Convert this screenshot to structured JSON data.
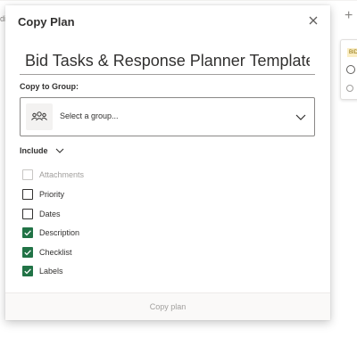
{
  "background": {
    "left_text": "di",
    "card_tag": "BID"
  },
  "dialog": {
    "title": "Copy Plan",
    "plan_name": "Bid Tasks & Response Planner Template",
    "group_label": "Copy to Group:",
    "group_placeholder": "Select a group...",
    "include_label": "Include",
    "options": [
      {
        "label": "Attachments",
        "checked": false,
        "disabled": true
      },
      {
        "label": "Priority",
        "checked": false,
        "disabled": false
      },
      {
        "label": "Dates",
        "checked": false,
        "disabled": false
      },
      {
        "label": "Description",
        "checked": true,
        "disabled": false
      },
      {
        "label": "Checklist",
        "checked": true,
        "disabled": false
      },
      {
        "label": "Labels",
        "checked": true,
        "disabled": false
      }
    ],
    "copy_button": "Copy plan"
  },
  "colors": {
    "checked": "#217346",
    "text": "#323130",
    "muted": "#a19f9d"
  },
  "icons": {
    "close": "close-icon",
    "group": "people-group-icon",
    "dropdown": "chevron-down-icon",
    "check": "checkmark-icon"
  }
}
